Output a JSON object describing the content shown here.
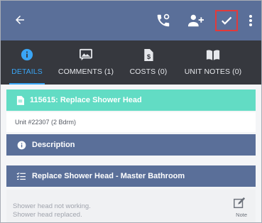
{
  "tabs": [
    {
      "label": "DETAILS",
      "icon": "info-icon",
      "active": true
    },
    {
      "label": "COMMENTS (1)",
      "icon": "comments-image-icon",
      "active": false
    },
    {
      "label": "COSTS (0)",
      "icon": "costs-document-icon",
      "active": false
    },
    {
      "label": "UNIT NOTES (0)",
      "icon": "book-icon",
      "active": false
    }
  ],
  "work_order": {
    "title": "115615: Replace Shower Head",
    "unit": "Unit #22307 (2 Bdrm)"
  },
  "description": {
    "header": "Description"
  },
  "task": {
    "title": "Replace Shower Head - Master Bathroom",
    "note_lines": [
      "Shower head not working.",
      "Shower head replaced."
    ],
    "note_button_label": "Note"
  },
  "colors": {
    "appbar": "#5a6f99",
    "tabbar": "#36383e",
    "active_tab": "#3aa5f5",
    "teal_header": "#62dcc4",
    "highlight_border": "#e23a3a"
  }
}
